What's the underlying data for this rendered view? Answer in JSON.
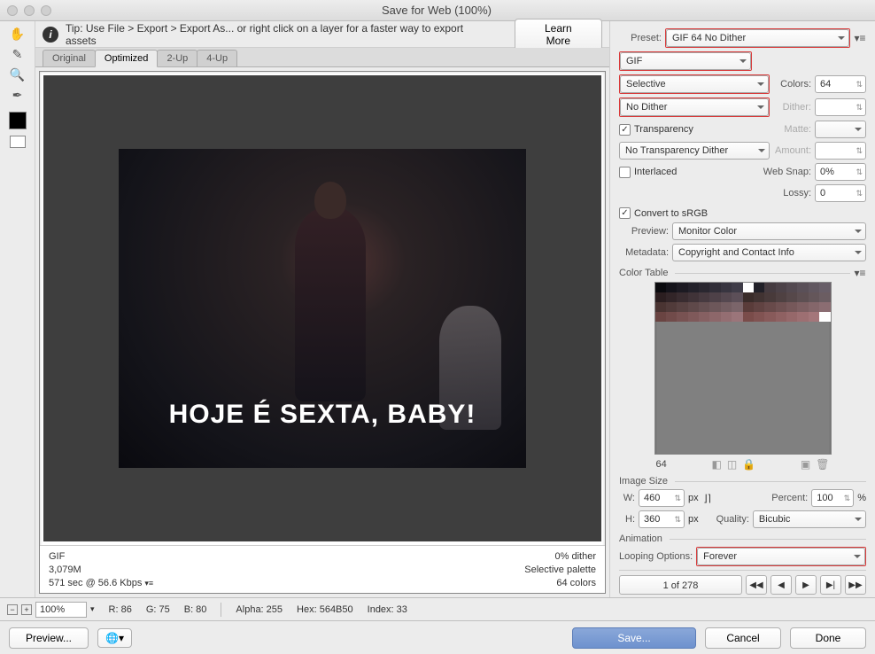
{
  "window": {
    "title": "Save for Web (100%)"
  },
  "tip": {
    "text": "Tip: Use File > Export > Export As...  or right click on a layer for a faster way to export assets",
    "learn_more": "Learn More"
  },
  "tabs": {
    "original": "Original",
    "optimized": "Optimized",
    "two_up": "2-Up",
    "four_up": "4-Up"
  },
  "image": {
    "caption": "HOJE É SEXTA, BABY!"
  },
  "image_status": {
    "format": "GIF",
    "size": "3,079M",
    "time": "571 sec @ 56.6 Kbps",
    "dither_pct": "0% dither",
    "palette": "Selective palette",
    "colors": "64 colors"
  },
  "preset": {
    "label": "Preset:",
    "value": "GIF 64 No Dither",
    "filetype": "GIF",
    "reduction": "Selective",
    "dither": "No Dither",
    "colors_label": "Colors:",
    "colors": "64",
    "dither_label": "Dither:",
    "dither_amt": "",
    "transparency_label": "Transparency",
    "matte_label": "Matte:",
    "trans_dither": "No Transparency Dither",
    "amount_label": "Amount:",
    "interlaced_label": "Interlaced",
    "websnap_label": "Web Snap:",
    "websnap": "0%",
    "lossy_label": "Lossy:",
    "lossy": "0",
    "srgb_label": "Convert to sRGB",
    "preview_label": "Preview:",
    "preview": "Monitor Color",
    "metadata_label": "Metadata:",
    "metadata": "Copyright and Contact Info"
  },
  "color_table": {
    "title": "Color Table",
    "count": "64"
  },
  "image_size": {
    "title": "Image Size",
    "w_label": "W:",
    "w": "460",
    "h_label": "H:",
    "h": "360",
    "px": "px",
    "percent_label": "Percent:",
    "percent": "100",
    "pct_sign": "%",
    "quality_label": "Quality:",
    "quality": "Bicubic"
  },
  "animation": {
    "title": "Animation",
    "loop_label": "Looping Options:",
    "loop": "Forever",
    "page": "1 of 278"
  },
  "status": {
    "zoom": "100%",
    "r": "R: 86",
    "g": "G: 75",
    "b": "B: 80",
    "alpha": "Alpha: 255",
    "hex": "Hex: 564B50",
    "index": "Index: 33"
  },
  "buttons": {
    "preview": "Preview...",
    "save": "Save...",
    "cancel": "Cancel",
    "done": "Done"
  },
  "swatch_colors": [
    "#0a0a0e",
    "#14131a",
    "#1c1a22",
    "#23212a",
    "#2a2730",
    "#312e38",
    "#383540",
    "#3f3c48",
    "#fff",
    "#212028",
    "#453b40",
    "#4c4248",
    "#534950",
    "#5a5058",
    "#615760",
    "#685e68",
    "#2b1e20",
    "#322528",
    "#392c30",
    "#403338",
    "#473a40",
    "#4e4148",
    "#554850",
    "#5c4f58",
    "#3a2c2a",
    "#413332",
    "#483a3a",
    "#4f4142",
    "#56484a",
    "#5d4f52",
    "#64565a",
    "#6b5d62",
    "#4a3432",
    "#513b3a",
    "#584242",
    "#5f494a",
    "#665052",
    "#6d575a",
    "#745e62",
    "#7b656a",
    "#5a3c3a",
    "#614342",
    "#684a4a",
    "#6f5152",
    "#76585a",
    "#7d5f62",
    "#84666a",
    "#8b6d72",
    "#6a4442",
    "#714b4a",
    "#785252",
    "#7f595a",
    "#866062",
    "#8d676a",
    "#946e72",
    "#9b757a",
    "#7a4c4a",
    "#815352",
    "#885a5a",
    "#8f6162",
    "#96686a",
    "#9d6f72",
    "#a4767a",
    "#ffffff"
  ]
}
